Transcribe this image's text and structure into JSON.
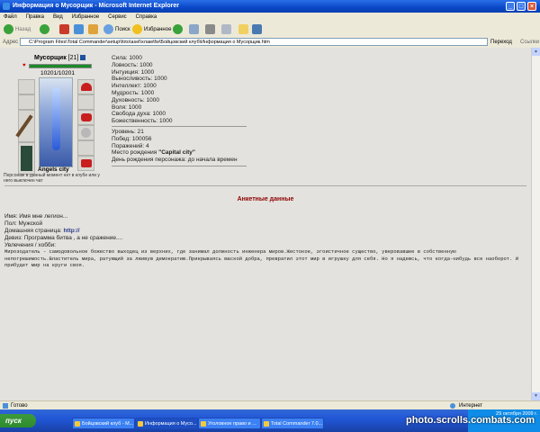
{
  "window": {
    "title": "Информация о Мусорщик - Microsoft Internet Explorer"
  },
  "menu": [
    "Файл",
    "Правка",
    "Вид",
    "Избранное",
    "Сервис",
    "Справка"
  ],
  "toolbar": {
    "back": "Назад",
    "search": "Поиск",
    "favorites": "Избранное"
  },
  "address": {
    "label": "Адрес",
    "value": "C:\\Program Files\\Total Commander\\setup\\foto\\asel\\хлам\\fw\\Бойцовский клуб\\Информация о Мусорщик.htm",
    "go": "Переход",
    "links": "Ссылки"
  },
  "character": {
    "name": "Мусорщик",
    "level": "[21]",
    "hp": "10201/10201",
    "hp_fraction": 1.0,
    "city": "Angels city",
    "note": "Персонаж в данный момент нет в клубе или у него выключен чат"
  },
  "stats": [
    "Сила: 1000",
    "Ловкость: 1000",
    "Интуиция: 1000",
    "Выносливость: 1000",
    "Интеллект: 1000",
    "Мудрость: 1000",
    "Духовность: 1000",
    "Воля: 1000",
    "Свобода духа: 1000",
    "Божественность: 1000"
  ],
  "info": {
    "level": "Уровень: 21",
    "wins": "Побед: 100056",
    "losses": "Поражений: 4",
    "birthplace_label": "Место рождения ",
    "birthplace_value": "\"Capital city\"",
    "birthday": "День рождения персонажа: до начала времен"
  },
  "profile": {
    "title": "Анкетные данные",
    "name": "Имя: Имя мне легион...",
    "gender": "Пол: Мужской",
    "homepage_label": "Домашняя страница: ",
    "homepage_value": "http://",
    "motto": "Девиз: Программа битва , а не сражение....",
    "hobbies_label": "Увлечения / хобби:",
    "hobbies_text": "Мирозодатель - самодовольное божество выходец из верхних, где занимал должность инженера миров.Жестокое, эгоистичное существо, уверовавшее в собственную непогрешимость.Властитель мира, ратующий за лживую демократию.Прикрываясь маской добра, превратил этот мир в игрушку для себя. Но я надеюсь, что когда-нибудь все наоборот. И прибудет мир на круги своя."
  },
  "statusbar": {
    "left": "Готово",
    "right": "Интернет"
  },
  "taskbar": {
    "start": "пуск",
    "tasks": [
      "Бойцовский клуб - M...",
      "Информация о Мусо...",
      "Уголовное право и ...",
      "Total Commander 7.0..."
    ],
    "clock": "29 октября 2009 г.",
    "watermark": "photo.scrolls.combats.com"
  }
}
